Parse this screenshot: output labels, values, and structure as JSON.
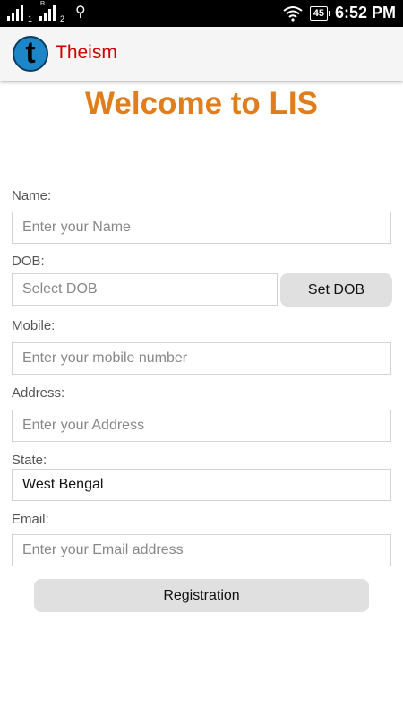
{
  "statusbar": {
    "sim1": "1",
    "sim2": "2",
    "sim2_mark": "R",
    "battery": "45",
    "time": "6:52 PM"
  },
  "appbar": {
    "title": "Theism",
    "logo_letter": "t"
  },
  "heading": "Welcome to LIS",
  "form": {
    "name": {
      "label": "Name:",
      "placeholder": "Enter your Name"
    },
    "dob": {
      "label": "DOB:",
      "placeholder": "Select DOB",
      "button": "Set DOB"
    },
    "mobile": {
      "label": "Mobile:",
      "placeholder": "Enter your mobile number"
    },
    "address": {
      "label": "Address:",
      "placeholder": "Enter your Address"
    },
    "state": {
      "label": "State:",
      "value": "West Bengal"
    },
    "email": {
      "label": "Email:",
      "placeholder": "Enter your Email address"
    },
    "submit": "Registration"
  },
  "colors": {
    "heading": "#e07e1d",
    "app_title": "#cc0000",
    "logo": "#1d86c9"
  }
}
